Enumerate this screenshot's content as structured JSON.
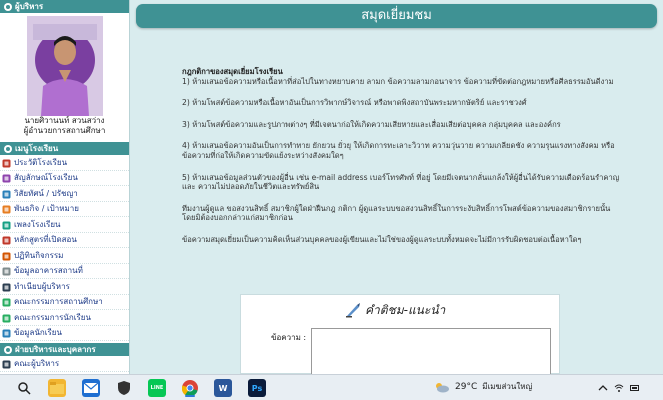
{
  "sidebar": {
    "admin_header": "ผู้บริหาร",
    "person_name": "นายศิวานนท์ สวนสว่าง",
    "person_title": "ผู้อำนวยการสถานศึกษา",
    "school_menu_header": "เมนูโรงเรียน",
    "menu_items": [
      {
        "label": "ประวัติโรงเรียน",
        "icon": "book-icon"
      },
      {
        "label": "สัญลักษณ์โรงเรียน",
        "icon": "emblem-icon"
      },
      {
        "label": "วิสัยทัศน์ / ปรัชญา",
        "icon": "eye-icon"
      },
      {
        "label": "พันธกิจ / เป้าหมาย",
        "icon": "target-icon"
      },
      {
        "label": "เพลงโรงเรียน",
        "icon": "music-icon"
      },
      {
        "label": "หลักสูตรที่เปิดสอน",
        "icon": "book-icon"
      },
      {
        "label": "ปฏิทินกิจกรรม",
        "icon": "calendar-icon"
      },
      {
        "label": "ข้อมูลอาคารสถานที่",
        "icon": "building-icon"
      },
      {
        "label": "ทำเนียบผู้บริหาร",
        "icon": "people-icon"
      },
      {
        "label": "คณะกรรมการสถานศึกษา",
        "icon": "group-icon"
      },
      {
        "label": "คณะกรรมการนักเรียน",
        "icon": "group-icon"
      },
      {
        "label": "ข้อมูลนักเรียน",
        "icon": "student-icon"
      }
    ],
    "staff_header": "ฝ่ายบริหารและบุคลากร",
    "staff_items": [
      {
        "label": "คณะผู้บริหาร",
        "icon": "people-icon"
      }
    ]
  },
  "main": {
    "banner_title": "สมุดเยี่ยมชม",
    "rules_title": "กฎกติกาของสมุดเยี่ยมโรงเรียน",
    "rules": [
      "1) ห้ามเสนอข้อความหรือเนื้อหาที่ส่อไปในทางหยาบคาย ลามก ข้อความลามกอนาจาร ข้อความที่ขัดต่อกฎหมายหรือศีลธรรมอันดีงาม",
      "2) ห้ามโพสต์ข้อความหรือเนื้อหาอันเป็นการวิพากษ์วิจารณ์ หรือพาดพิงสถาบันพระมหากษัตริย์ และราชวงศ์",
      "3) ห้ามโพสต์ข้อความและรูปภาพต่างๆ ที่มีเจตนาก่อให้เกิดความเสียหายและเสื่อมเสียต่อบุคคล กลุ่มบุคคล และองค์กร",
      "4) ห้ามเสนอข้อความอันเป็นการทำทาย ยักยวน ยั่วยุ ให้เกิดการทะเลาะวิวาท ความวุ่นวาย ความเกลียดชัง ความรุนแรงทางสังคม หรือ ข้อความที่ก่อให้เกิดความขัดแย้งระหว่างสังคมใดๆ",
      "5) ห้ามเสนอข้อมูลส่วนตัวของผู้อื่น เช่น e-mail address เบอร์โทรศัพท์ ที่อยู่ โดยมีเจตนากลั่นแกล้งให้ผู้อื่นได้รับความเดือดร้อนรำคาญ และ ความไม่ปลอดภัยในชีวิตและทรัพย์สิน"
    ],
    "notice_paragraph": "ทีมงานผู้ดูแล ขอสงวนสิทธิ์ สมาชิกผู้ใดฝ่าฝืนกฎ กติกา ผู้ดูแลระบบขอสงวนสิทธิ์ในการระงับสิทธิ์การโพสต์ข้อความของสมาชิกรายนั้น โดยมิต้องบอกกล่าวแก่สมาชิกก่อน",
    "disclaimer": "ข้อความสมุดเยี่ยมเป็นความคิดเห็นส่วนบุคคลของผู้เขียนและไม่ใช่ของผู้ดูแลระบบทั้งหมดจะไม่มีการรับผิดชอบต่อเนื้อหาใดๆ",
    "form": {
      "logo_text": "คำติชม-แนะนำ",
      "message_label": "ข้อความ :",
      "message_value": ""
    }
  },
  "taskbar": {
    "apps": [
      {
        "name": "search-icon",
        "color": "#2b7bd6"
      },
      {
        "name": "file-explorer-icon",
        "color": "#f2b632"
      },
      {
        "name": "mail-icon",
        "color": "#1f6fd1"
      },
      {
        "name": "security-shield-icon",
        "color": "#333333"
      },
      {
        "name": "line-app-icon",
        "color": "#06c755"
      },
      {
        "name": "chrome-icon",
        "color": "#db4437"
      },
      {
        "name": "word-icon",
        "color": "#2b579a"
      },
      {
        "name": "photoshop-icon",
        "color": "#0b1b3a"
      }
    ],
    "temperature": "29°C",
    "weather_text": "มีเมฆส่วนใหญ่"
  },
  "colors": {
    "accent": "#3f9294",
    "page_bg": "#d9ecee",
    "menu_text": "#1f3c88"
  }
}
